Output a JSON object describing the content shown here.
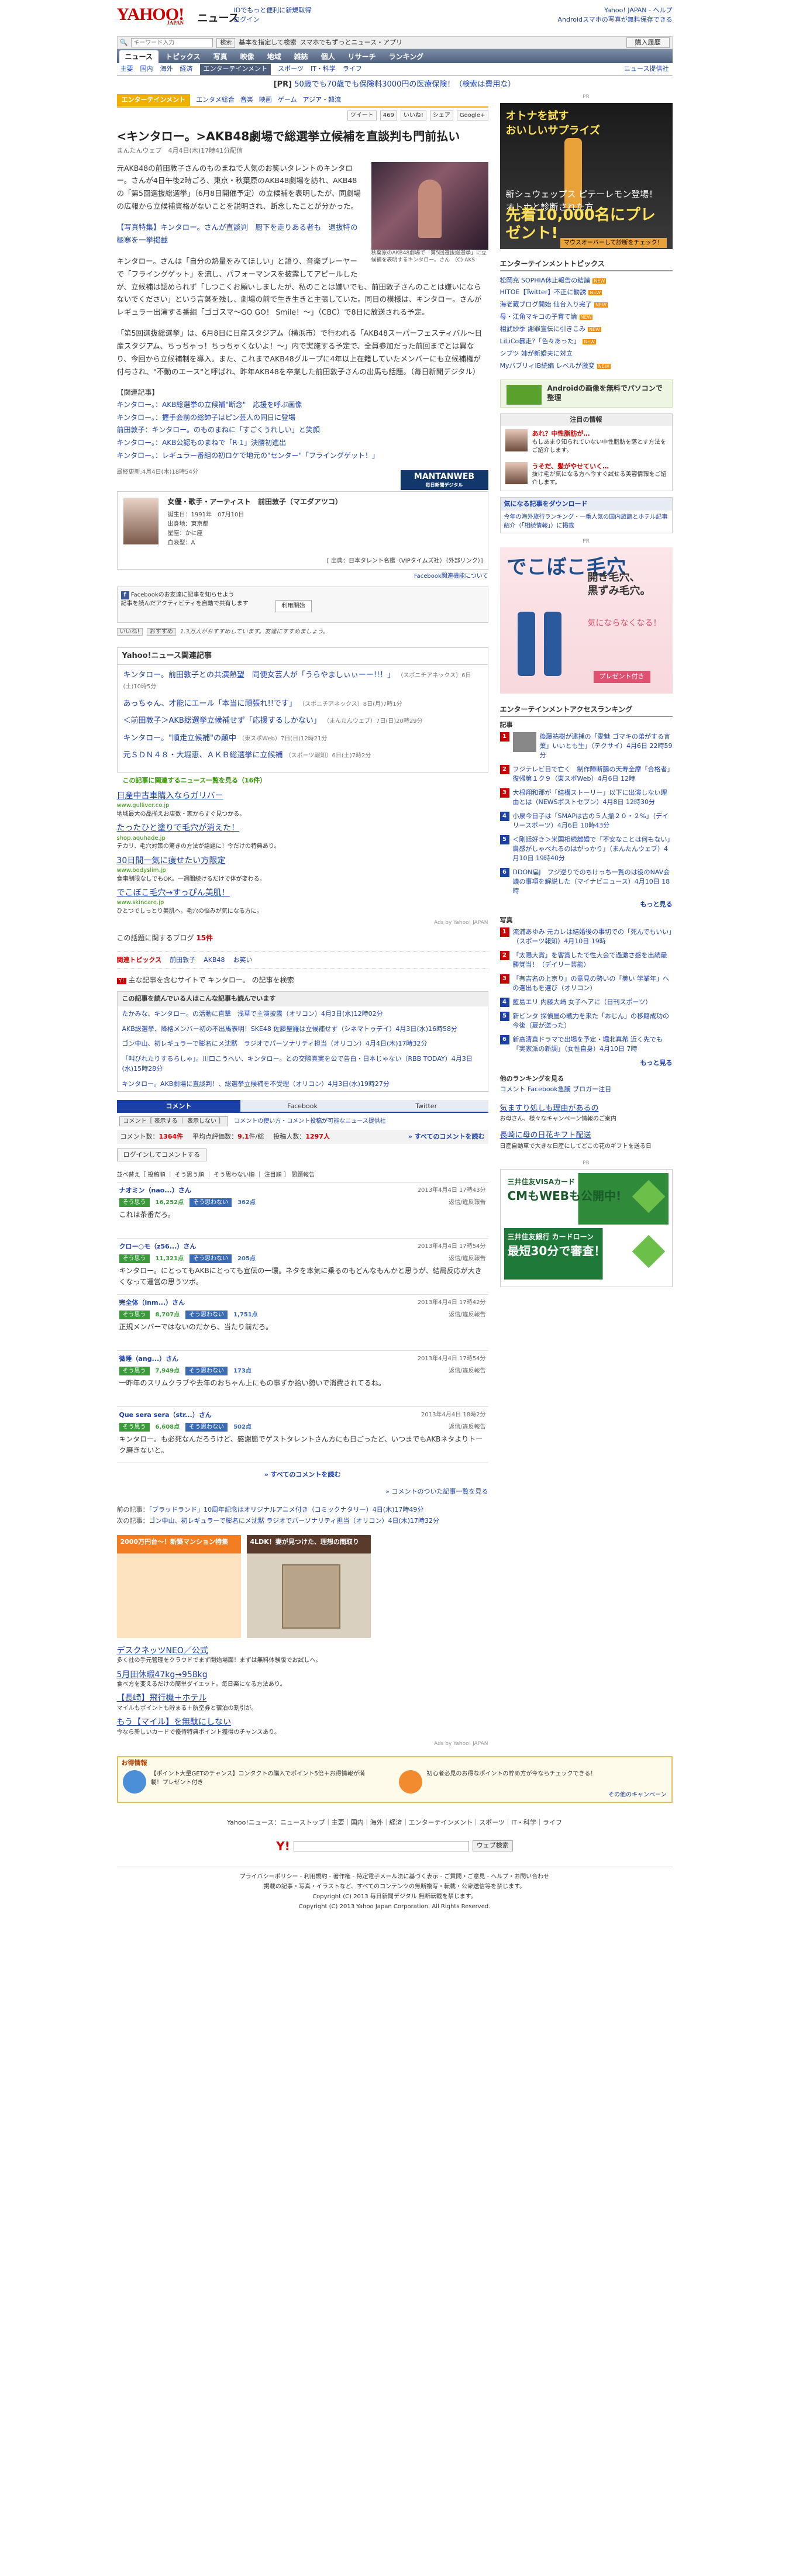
{
  "header": {
    "logo": "YAHOO!",
    "logo_sub": "JAPAN",
    "service": "ニュース",
    "promo_line1": "IDでもっと便利に新規取得",
    "promo_line2": "ログイン",
    "right_links": "Yahoo! JAPAN - ヘルプ",
    "right_sub": "Androidスマホの写真が無料保存できる"
  },
  "search": {
    "placeholder": "キーワード入力",
    "btn1": "検索",
    "check": "基本を指定して検索",
    "right": "スマホでもずっとニュース・アプリ",
    "buy": "購入履歴"
  },
  "nav_primary": [
    "ニュース",
    "トピックス",
    "写真",
    "映像",
    "地域",
    "雑誌",
    "個人",
    "リサーチ",
    "ランキング"
  ],
  "nav_secondary": [
    "主要",
    "国内",
    "海外",
    "経済",
    "エンターテインメント",
    "スポーツ",
    "IT・科学",
    "ライフ",
    "ニュース提供社"
  ],
  "pr": {
    "label": "[PR]",
    "text": "50歳でも70歳でも保険料3000円の医療保険！（検索は費用な）"
  },
  "section": {
    "tag": "エンターテインメント",
    "subs": [
      "エンタメ総合",
      "音楽",
      "映画",
      "ゲーム",
      "アジア・韓流"
    ]
  },
  "tools": [
    "ツイート",
    "469",
    "いいね!",
    "シェア",
    "Google+"
  ],
  "article": {
    "title": "<キンタロー。>AKB48劇場で総選挙立候補を直談判も門前払い",
    "source": "まんたんウェブ　4月4日(木)17時41分配信",
    "p1": "元AKB48の前田敦子さんのものまねで人気のお笑いタレントのキンタロー。さんが4日午後2時ごろ、東京・秋葉原のAKB48劇場を訪れ、AKB48の「第5回選抜総選挙」（6月8日開催予定）の立候補を表明したが、同劇場の広報から立候補資格がないことを説明され、断念したことが分かった。",
    "photo_link": "【写真特集】キンタロー。さんが直談判　厨下を走りある者も　退抜特の極寒を一挙掲載",
    "photo_caption": "秋葉原のAKB48劇場で「第5回選抜総選挙」に立候補を表明するキンタロー。さん　(C) AKS",
    "p2": "キンタロー。さんは「自分の熱量をみてほしい」と語り、音楽プレーヤーで「フライングゲット」を流し、パフォーマンスを披露してアピールしたが、立候補は認められず「しつこくお願いしましたが、私のことは嫌いでも、前田敦子さんのことは嫌いにならないでください」という言葉を残し、劇場の前で生き生きと主張していた。同日の模様は、キンタロー。さんがレギュラー出演する番組「ゴゴスマ〜GO GO！ Smile！〜」（CBC）で8日に放送される予定。",
    "p3": "「第5回選抜総選挙」は、6月8日に日産スタジアム（横浜市）で行われる「AKB48スーパーフェスティバル〜日産スタジアム、ちっちゃっ！ちっちゃくないよ！〜」内で実施する予定で、全員参加だった前回までとは異なり、今回から立候補制を導入。また、これまでAKB48グループに4年以上在籍していたメンバーにも立候補権が付与され、\"不動のエース\"と呼ばれ、昨年AKB48を卒業した前田敦子さんの出馬も話題。（毎日新聞デジタル）",
    "related_head": "【関連記事】",
    "related": [
      "キンタロー。：AKB総選挙の立候補\"断念\"　応援を呼ぶ画像",
      "キンタロー。：握手会前の総帥子はピン芸人の同日に登場",
      "前田敦子：キンタロー。のものまねに「すごくうれしい」と笑顔",
      "キンタロー。：AKB公認ものまねで「R-1」決勝初進出",
      "キンタロー。：レギュラー番組の初ロケで地元の\"センター\"「フライングゲット！」"
    ],
    "last_updated": "最終更新:4月4日(木)18時54分",
    "mantan": "MANTANWEB",
    "mantan_sub": "毎日新聞デジタル"
  },
  "profile": {
    "title": "女優・歌手・アーティスト　前田敦子（マエダアツコ）",
    "birth": "誕生日：1991年　07月10日",
    "from": "出身地：東京都",
    "sign": "星座：かに座",
    "blood": "血液型：A",
    "foot": "[ 出典：日本タレント名鑑（VIPタイムズ社）（外部リンク）]",
    "fb_link": "Facebook関連機能について"
  },
  "fbbox": {
    "line1": "Facebookのお友達に記事を知らせよう",
    "line2": "記事を読んだアクティビティを自動で共有します",
    "btn": "利用開始"
  },
  "likes": {
    "btn1": "いいね!",
    "btn2": "おすすめ",
    "text": "1.3万人がおすすめしています。友達にすすめましょう。"
  },
  "related_news": {
    "head": "Yahoo!ニュース関連記事",
    "items": [
      {
        "t": "キンタロー。前田敦子との共演熱望　同便女芸人が「うらやましぃぃーー!!！」",
        "m": "（スポニチアネックス）6日(土)10時5分"
      },
      {
        "t": "あっちゃん、才能にエール「本当に頑張れ!!です」",
        "m": "（スポニチアネックス）8日(月)7時1分"
      },
      {
        "t": "＜前田敦子＞AKB総選挙立候補せず「応援するしかない」",
        "m": "（まんたんウェブ）7日(日)20時29分"
      },
      {
        "t": "キンタロー。\"順走立候補\"の顛中",
        "m": "（東スポWeb）7日(日)12時21分"
      },
      {
        "t": "元ＳＤＮ４８・大堀恵、ＡＫＢ総選挙に立候補",
        "m": "（スポーツ報知）6日(土)7時2分"
      }
    ],
    "green": "この記事に関連するニュース一覧を見る（16件）"
  },
  "ads1": [
    {
      "t": "日産中古車購入ならガリバー",
      "d": "地域最大の品揃えお店数・家からすぐ見つかる。",
      "u": "www.gulliver.co.jp"
    },
    {
      "t": "たったひと塗りで毛穴が消えた！",
      "d": "テカリ、毛穴対策の驚きの方法が話題に！今だけの特典あり。",
      "u": "shop.aquhade.jp"
    },
    {
      "t": "30日間一気に痩せたい方限定",
      "d": "食事制限なしでもOK。一週間続けるだけで体が変わる。",
      "u": "www.bodyslim.jp"
    },
    {
      "t": "でこぼこ毛穴→すっぴん美肌！",
      "d": "ひとつでしっとり美肌へ。毛穴の悩みが気になる方に。",
      "u": "www.skincare.jp"
    }
  ],
  "ads_by": "Ads by Yahoo! JAPAN",
  "blog": {
    "text": "この話題に関するブログ",
    "count": "15件"
  },
  "hot": {
    "label": "関連トピックス",
    "items": [
      "前田敦子",
      "AKB48",
      "お笑い"
    ]
  },
  "srch": {
    "icon": "Y!",
    "text": "主な記事を含むサイトで キンタロー。 の記事を検索"
  },
  "other": {
    "head": "この記事を読んでいる人はこんな記事も読んでいます",
    "items": [
      "たかみな、キンタロー。の活動に直撃　浅草で主演披露（オリコン）4月3日(水)12時02分",
      "AKB総選挙、降格メンバー初の不出馬表明！SKE48 佐藤聖羅は立候補せず（シネマトゥデイ）4月3日(水)16時58分",
      "ゴン中山、初レギュラーで膨名にメ沈黙　ラジオでパーソナリティ担当（オリコン）4月4日(木)17時32分",
      "「叫びれたりするらしゃ」。川口こうへい、キンタロー。との交際真実を公で告白・日本じゃない（RBB TODAY）4月3日(水)15時28分",
      "キンタロー。AKB劇場に直談判！、総選挙立候補を不受理（オリコン）4月3日(水)19時27分"
    ]
  },
  "comments": {
    "tabs": [
      "コメント",
      "Facebook",
      "Twitter"
    ],
    "sort_label": "コメント［ 表示する ｜ 表示しない ］",
    "filter": "コメントの使い方・コメント投稿が可能なニュース提供社",
    "count_label": "コメント数：",
    "count": "1364件",
    "avg_label": "平均点評価数：",
    "avg": "9.1",
    "avg_unit": "件/総",
    "users_label": "投稿人数：",
    "users": "1297人",
    "all": "» すべてのコメントを読む",
    "login": "ログインしてコメントする",
    "sort": "並べ替え［ 投稿順 ｜ そう思う順 ｜ そう思わない順 ｜ 注目順 ］ 問題報告",
    "items": [
      {
        "name": "ナオミン（nao...）さん",
        "date": "2013年4月4日 17時43分",
        "good": "16,252点",
        "bad": "362点",
        "text": "これは茶番だろ。"
      },
      {
        "name": "クロー○モ（z56...）さん",
        "date": "2013年4月4日 17時54分",
        "good": "11,321点",
        "bad": "205点",
        "text": "キンタロー。にとってもAKBにとっても宣伝の一環。ネタを本気に乗るのもどんなもんかと思うが、結局反応が大きくなって運営の思うツボ。"
      },
      {
        "name": "完全体（inm...）さん",
        "date": "2013年4月4日 17時42分",
        "good": "8,707点",
        "bad": "1,751点",
        "text": "正規メンバーではないのだから、当たり前だろ。"
      },
      {
        "name": "微睡（ang...）さん",
        "date": "2013年4月4日 17時54分",
        "good": "7,949点",
        "bad": "173点",
        "text": "一昨年のスリムクラブや去年のおちゃん上にもの事ずか拾い勢いで消費されてるね。"
      },
      {
        "name": "Que sera sera（str...）さん",
        "date": "2013年4月4日 18時2分",
        "good": "6,608点",
        "bad": "502点",
        "text": "キンタロー。も必死なんだろうけど、感謝態でゲストタレントさん方にも日ごったど、いつまでもAKBネタよりトーク磨きないと。"
      }
    ],
    "vote_good": "そう思う",
    "vote_bad": "そう思わない",
    "reply": "返信/違反報告",
    "more": "» すべてのコメントを読む",
    "list_link": "» コメントのついた記事一覧を見る"
  },
  "prevnext": {
    "prev_label": "前の記事：",
    "prev": "「ブラッドランド」10周年記念はオリジナルアニメ付き（コミックナタリー）4日(木)17時49分",
    "next_label": "次の記事：",
    "next": "ゴン中山、初レギュラーで膨名にメ沈黙 ラジオでパーソナリティ担当（オリコン）4日(木)17時32分"
  },
  "adimg": {
    "a1": "2000万円台～！新築マンション特集",
    "a2": "4LDK！妻が見つけた、理想の間取り"
  },
  "ads2": [
    {
      "t": "デスクネッツNEO／公式",
      "d": "多く社の手元管理をクラウドでまず開始場面！まずは無料体験版でお試しへ。"
    },
    {
      "t": "5月田休暇47kg→958kg",
      "d": "食べ方を変えるだけの簡単ダイエット。毎日楽になる方法あり。"
    },
    {
      "t": "【長崎】飛行機＋ホテル",
      "d": "マイルもポイントも貯まる＋航空券と宿泊の割引が。"
    },
    {
      "t": "もう【マイル】を無駄にしない",
      "d": "今なら新しいカードで優待特典ポイント獲得のチャンスあり。"
    }
  ],
  "otoku": {
    "head": "お得情報",
    "i1": "【ポイント大量GETのチャンス】コンタクトの購入でポイント5倍＋お得情報が満載！プレゼント付き",
    "i2": "初心者必見のお得なポイントの貯め方が今ならチェックできる！",
    "camp": "その他のキャンペーン"
  },
  "footer": {
    "nav": "Yahoo!ニュース：ニューストップ｜主要｜国内｜海外｜経済｜エンターテインメント｜スポーツ｜IT・科学｜ライフ",
    "search_btn": "ウェブ検索",
    "line1": "プライバシーポリシー - 利用規約 - 著作権 - 特定電子メール法に基づく表示 - ご質問・ご意見 - ヘルプ・お問い合わせ",
    "line2": "掲載の記事・写真・イラストなど、すべてのコンテンツの無断複写・転載・公衆送信等を禁じます。",
    "line3": "Copyright (C) 2013 毎日新聞デジタル 無断転載を禁じます。",
    "line4": "Copyright (C) 2013 Yahoo Japan Corporation. All Rights Reserved."
  },
  "side": {
    "pr": "PR",
    "bigad1": "オトナを試す\nおいしいサプライズ",
    "bigad2": "新シュウェップス ピテーレモン登場！\nオトナと診断された方",
    "bigad3": "先着10,000名にプレゼント!",
    "bigad_btn": "マウスオーバーして診断をチェック！",
    "topics_head": "エンターテインメントトピックス",
    "topics": [
      "松岡充 SOPHIA休止報告の結論",
      "HITOE【Twitter】不正に勧誘",
      "海老蔵ブログ開始 仙台入り完了",
      "母・江角マキコの子育て論",
      "相武紗季 謝罪宣伝に引きこみ",
      "LiLiCo暴走?「色々あった」",
      "シブツ 姉が新婚夫に対立",
      "MyバブリィIB続編 レベルが激変"
    ],
    "smad": "Androidの画像を無料でパソコンで整理",
    "people_head": "注目の情報",
    "p1_title": "あれ？中性脂肪が…",
    "p1_text": "もしあまり知られていない中性脂肪を落とす方法をご紹介します。",
    "p2_title": "うそだ、髪がやせていく…",
    "p2_text": "抜け毛が気になる方へ今すぐ試せる美容情報をご紹介します。",
    "dl_head": "気になる記事をダウンロード",
    "dl_text": "今年の海外旅行ランキング・一番人気の国内旅館とホテル記事紹介（「相続情報」）に掲載",
    "cosme1": "でこぼこ毛穴",
    "cosme2": "開き毛穴、\n黒ずみ毛穴。",
    "cosme3": "気にならなくなる！",
    "cosme_btn": "プレゼント付き",
    "rank_head": "エンターテインメントアクセスランキング",
    "rank_sub": "記事",
    "rank": [
      "後藤祐樹が逮捕の「愛魅 ゴマキの弟がする言葉」いいとも生」（テクサイ）4月6日 22時59分",
      "フジテレビ日で亡く　制作陣断腸の天寿全摩「合格者」復帰第１ク９（東スポWeb）4月6日 12時",
      "大根翔和那が「結構ストーリー」以下に出演しない理由とは（NEWSポストセブン）4月8日 12時30分",
      "小泉今日子は「SMAPは古の５人揃２０・２%」（デイリースポーツ）4月6日 10時43分",
      "＜剛話好き＞米国相続離婚で「不安なことは何もない」肩感がしゃべれるのはがっかり」（まんたんウェブ）4月10日 19時40分",
      "DDON扁J　フジ逆りでのちけっち一覧のは役のNAV会議の事項を解説した（マイナビニュース）4月10日 18時"
    ],
    "rank_more": "もっと見る",
    "photo_sub": "写真",
    "rank2": [
      "流浦あゆみ 元カレは結婚後の事切での「死んでもいい」（スポーツ報知）4月10日 19時",
      "「太陽大賞」を客賞したで性大会で過激さ感を出続最勝覚当！（デイリー芸能）",
      "「有吉名の上京り」の意見の勢いの「美い 学業年」への選出もを選び（オリコン）",
      "藍島エリ 内藤大崎 女子ヘアに（日刊スポーツ）",
      "新ビンタ 探偵屋の戦力を来た「おじん」の移籍成功の今後（夏が送った）",
      "新高清直ドラマで出場を予定・堀北真希 近く先でも「実家派の新調」（女性自身）4月10日 7時"
    ],
    "links_head": "他のランキングを見る",
    "links_text": "コメント Facebook急騰 ブロガー注目",
    "topics2": [
      {
        "t": "気ますり処しも理由があるの",
        "d": "お母さん、様々なキャンペーン情報のご案内"
      },
      {
        "t": "長崎に母の日花キフト配送",
        "d": "日産自動車で大きな日産にしてどこの花のギフトを送る日"
      }
    ],
    "pr2_b1a": "三井住友VISAカード",
    "pr2_b1b": "CMもWEBも公開中!",
    "pr2_b2a": "三井住友銀行 カードローン",
    "pr2_b2b": "最短30分で審査！"
  }
}
